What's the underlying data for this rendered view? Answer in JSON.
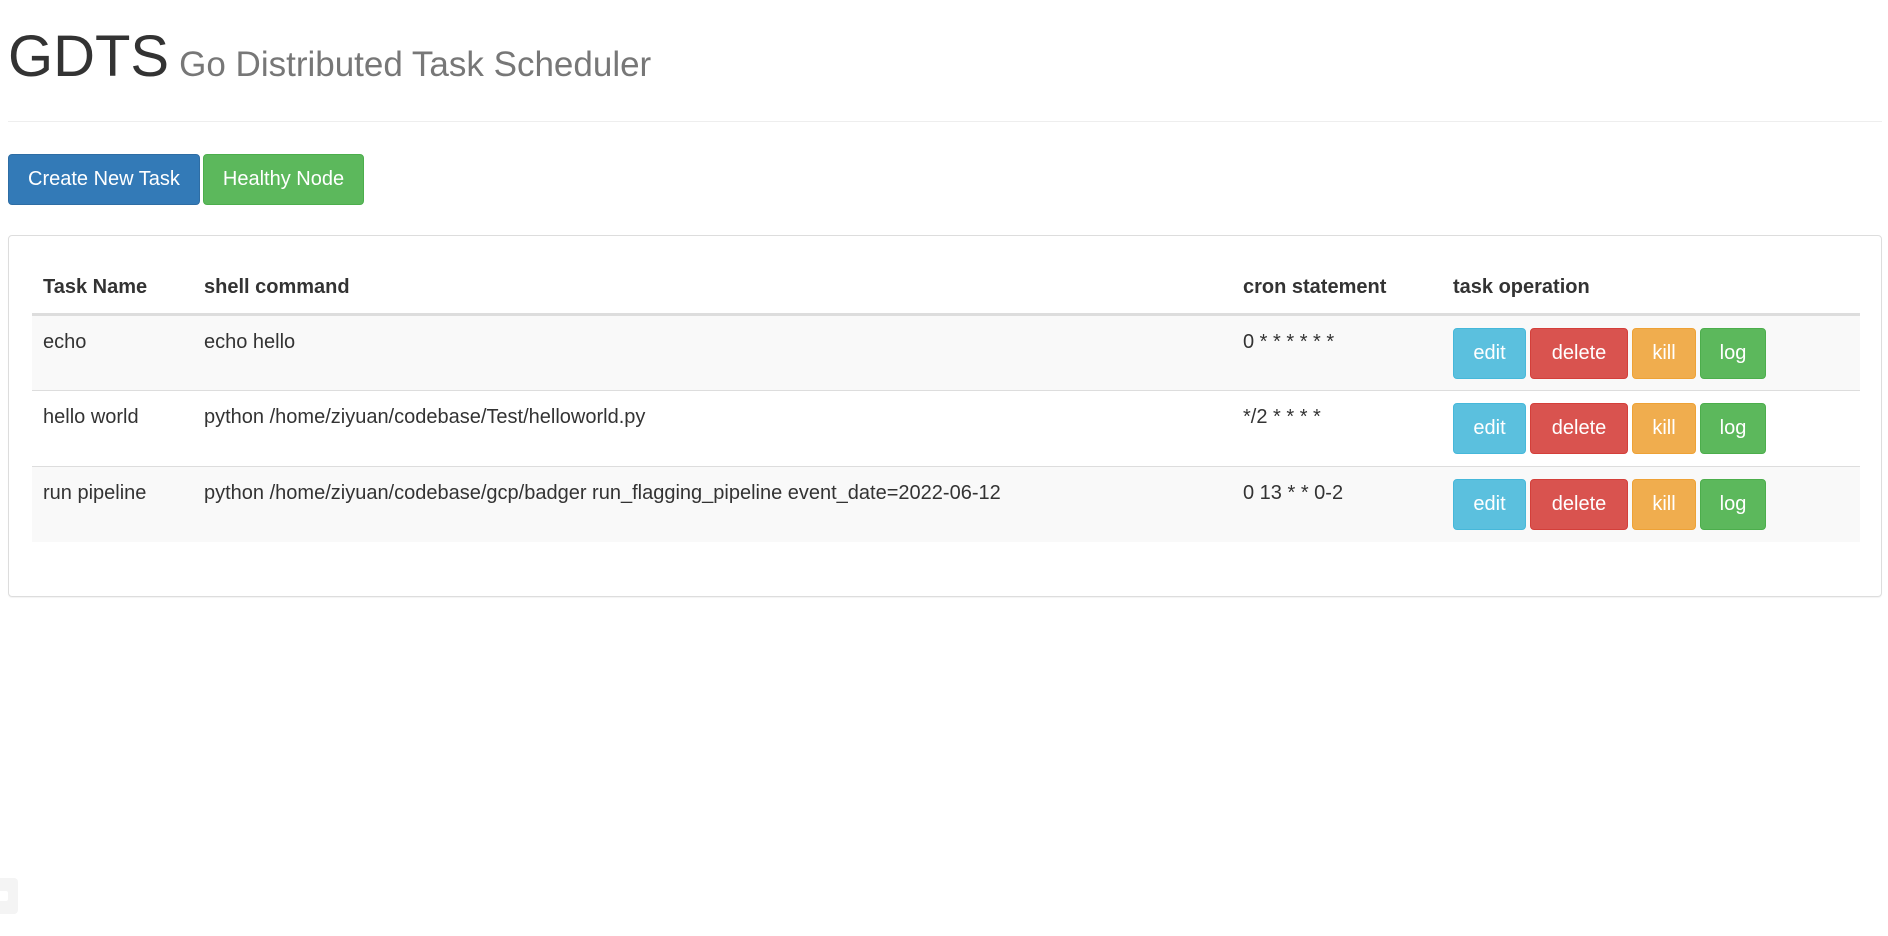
{
  "header": {
    "title": "GDTS",
    "subtitle": "Go Distributed Task Scheduler"
  },
  "toolbar": {
    "create_label": "Create New Task",
    "healthy_label": "Healthy Node"
  },
  "table": {
    "columns": [
      "Task Name",
      "shell command",
      "cron statement",
      "task operation"
    ],
    "rows": [
      {
        "name": "echo",
        "command": "echo hello",
        "cron": "0 * * * * * *"
      },
      {
        "name": "hello world",
        "command": "python /home/ziyuan/codebase/Test/helloworld.py",
        "cron": "*/2 * * * *"
      },
      {
        "name": "run pipeline",
        "command": "python /home/ziyuan/codebase/gcp/badger run_flagging_pipeline event_date=2022-06-12",
        "cron": "0 13 * * 0-2"
      }
    ],
    "operations": {
      "edit": "edit",
      "delete": "delete",
      "kill": "kill",
      "log": "log"
    }
  },
  "colors": {
    "primary": "#337ab7",
    "success": "#5cb85c",
    "info": "#5bc0de",
    "danger": "#d9534f",
    "warning": "#f0ad4e"
  }
}
